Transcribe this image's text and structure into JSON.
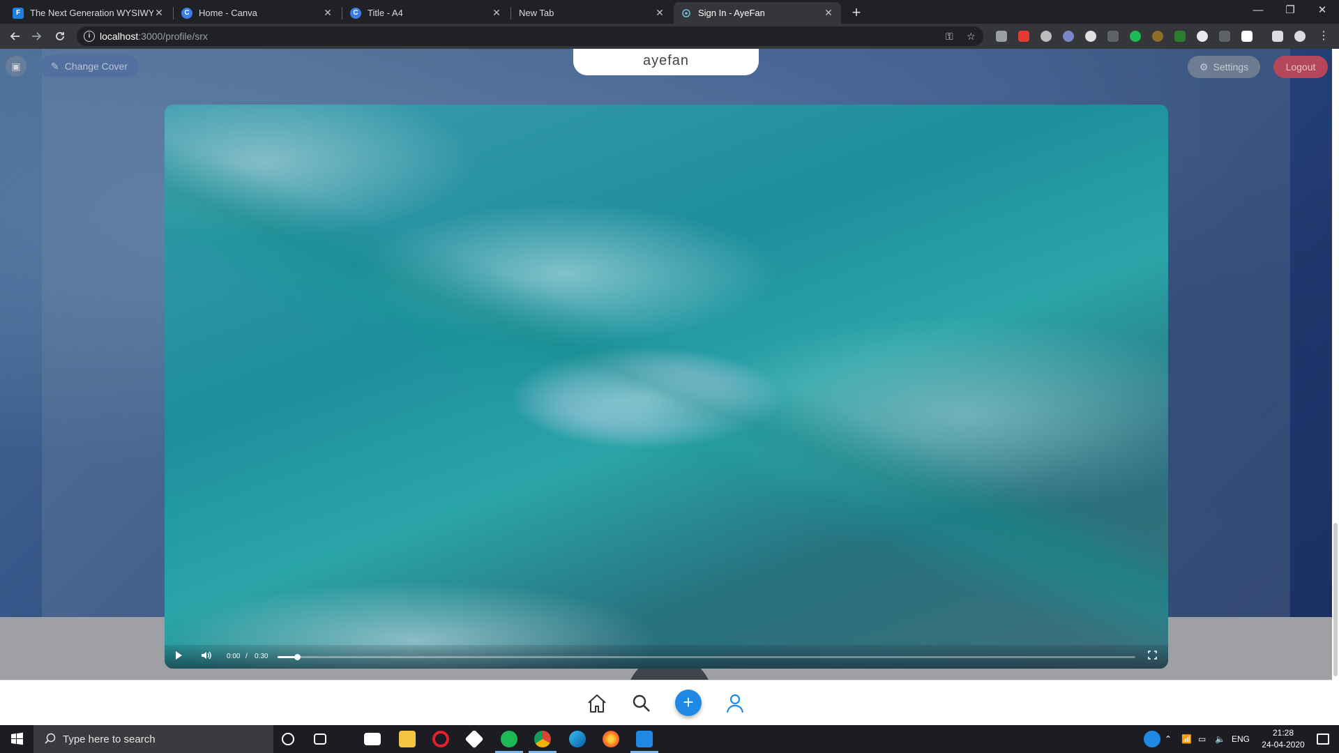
{
  "browser": {
    "tabs": [
      {
        "title": "The Next Generation WYSIWYG",
        "favicon": "F",
        "favicon_color": "#1f7fe0",
        "active": false
      },
      {
        "title": "Home - Canva",
        "favicon": "C",
        "favicon_color": "#3d7de8",
        "active": false
      },
      {
        "title": "Title - A4",
        "favicon": "C",
        "favicon_color": "#3d7de8",
        "active": false
      },
      {
        "title": "New Tab",
        "favicon": "",
        "favicon_color": "",
        "active": false
      },
      {
        "title": "Sign In - AyeFan",
        "favicon": "",
        "favicon_color": "#6cc7d8",
        "active": true
      }
    ],
    "tab_close_glyph": "✕",
    "new_tab_glyph": "+",
    "window_controls": {
      "minimize": "—",
      "maximize": "❐",
      "close": "✕"
    },
    "url_host": "localhost",
    "url_path": ":3000/profile/srx"
  },
  "page": {
    "logo": "ayefan",
    "change_cover_label": "Change Cover",
    "settings_label": "Settings",
    "logout_label": "Logout",
    "colors": {
      "accent": "#1e88e5",
      "logout": "#b4485a"
    },
    "video": {
      "current_time": "0:00",
      "separator": "/",
      "duration": "0:30",
      "progress": 0.023
    }
  },
  "taskbar": {
    "search_placeholder": "Type here to search",
    "language": "ENG",
    "time": "21:28",
    "date": "24-04-2020"
  }
}
